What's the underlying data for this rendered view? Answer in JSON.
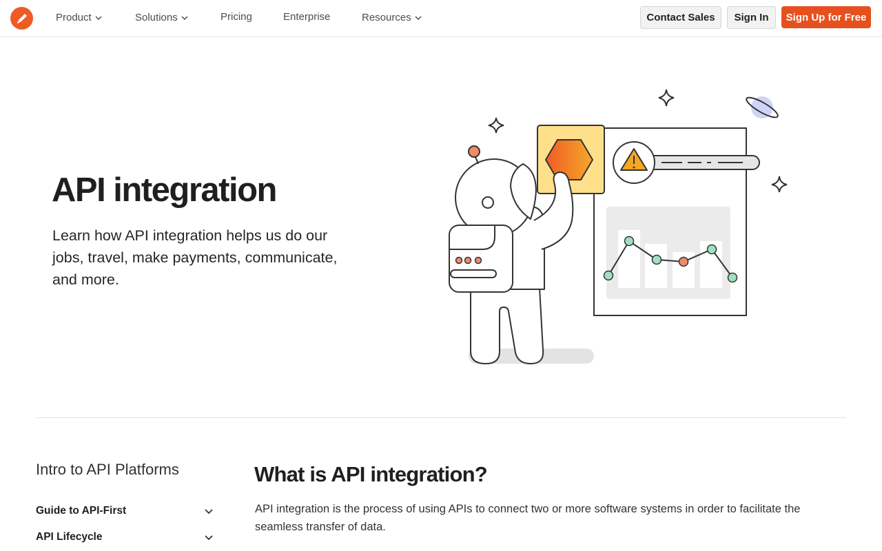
{
  "nav": {
    "items": [
      {
        "label": "Product",
        "dropdown": true
      },
      {
        "label": "Solutions",
        "dropdown": true
      },
      {
        "label": "Pricing",
        "dropdown": false
      },
      {
        "label": "Enterprise",
        "dropdown": false
      },
      {
        "label": "Resources",
        "dropdown": true
      }
    ],
    "contact_sales": "Contact Sales",
    "sign_in": "Sign In",
    "sign_up": "Sign Up for Free"
  },
  "hero": {
    "title": "API integration",
    "subtitle": "Learn how API integration helps us do our jobs, travel, make payments, communicate, and more."
  },
  "sidebar": {
    "title": "Intro to API Platforms",
    "items": [
      {
        "label": "Guide to API-First"
      },
      {
        "label": "API Lifecycle"
      }
    ]
  },
  "article": {
    "title": "What is API integration?",
    "body": "API integration is the process of using APIs to connect two or more software systems in order to facilitate the seamless transfer of data."
  },
  "colors": {
    "brand": "#ef5b25",
    "primary_button": "#e6501f",
    "chart_point_green": "#9fe0c0",
    "chart_point_red": "#ef8a6a",
    "hexagon_panel": "#ffe08a"
  },
  "icons": {
    "logo": "postman-rocket-logo",
    "chevron": "chevron-down-icon",
    "warning": "warning-triangle-icon"
  }
}
